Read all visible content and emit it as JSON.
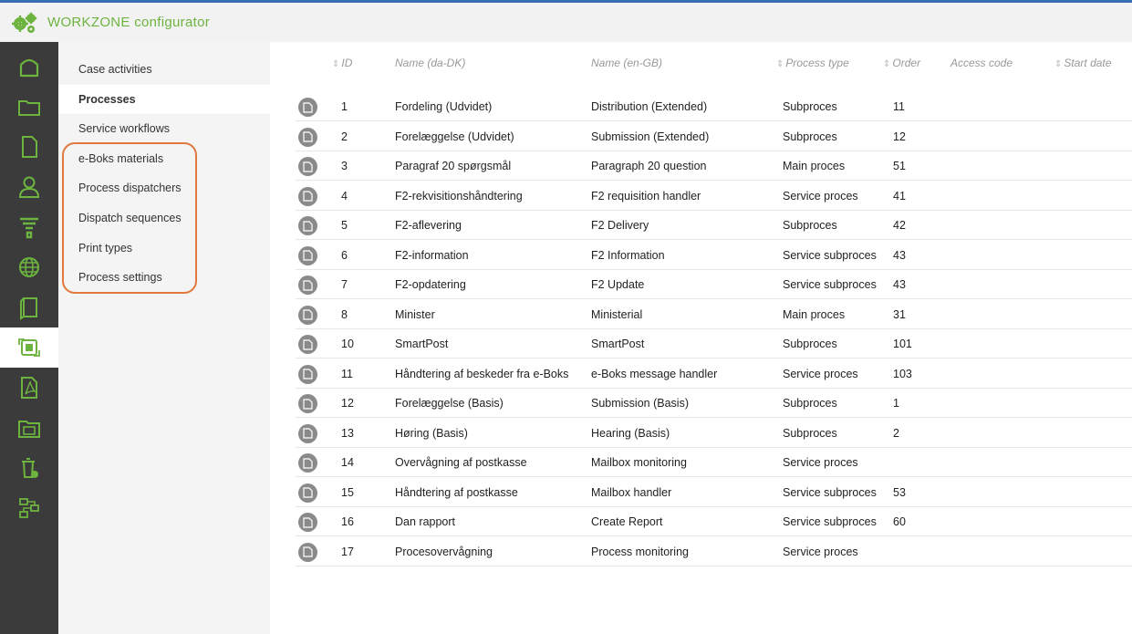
{
  "app": {
    "title_brand": "WORKZONE",
    "title_rest": " configurator",
    "accent": "#6db33f",
    "rail_bg": "#3b3b3b",
    "icon_color": "#6db33f"
  },
  "rail": {
    "items": [
      {
        "icon": "home-icon"
      },
      {
        "icon": "folder-icon"
      },
      {
        "icon": "document-icon"
      },
      {
        "icon": "user-icon"
      },
      {
        "icon": "filter-icon"
      },
      {
        "icon": "globe-icon"
      },
      {
        "icon": "book-icon"
      },
      {
        "icon": "workflow-icon",
        "active": true
      },
      {
        "icon": "pdf-icon"
      },
      {
        "icon": "archive-icon"
      },
      {
        "icon": "trash-icon"
      },
      {
        "icon": "flow-icon"
      }
    ]
  },
  "sidebar": {
    "items": [
      {
        "label": "Case activities"
      },
      {
        "label": "Processes",
        "active": true
      },
      {
        "label": "Service workflows"
      },
      {
        "label": "e-Boks materials"
      },
      {
        "label": "Process dispatchers"
      },
      {
        "label": "Dispatch sequences"
      },
      {
        "label": "Print types"
      },
      {
        "label": "Process settings"
      }
    ]
  },
  "table": {
    "columns": [
      {
        "label": "ID",
        "sortable": true
      },
      {
        "label": "Name (da-DK)",
        "sortable": false
      },
      {
        "label": "Name (en-GB)",
        "sortable": false
      },
      {
        "label": "Process type",
        "sortable": true
      },
      {
        "label": "Order",
        "sortable": true
      },
      {
        "label": "Access code",
        "sortable": false
      },
      {
        "label": "Start date",
        "sortable": true
      }
    ],
    "sort_glyph": "⇕",
    "rows": [
      {
        "id": "1",
        "name_da": "Fordeling (Udvidet)",
        "name_en": "Distribution (Extended)",
        "type": "Subproces",
        "order": "11"
      },
      {
        "id": "2",
        "name_da": "Forelæggelse (Udvidet)",
        "name_en": "Submission (Extended)",
        "type": "Subproces",
        "order": "12"
      },
      {
        "id": "3",
        "name_da": "Paragraf 20 spørgsmål",
        "name_en": "Paragraph 20 question",
        "type": "Main proces",
        "order": "51"
      },
      {
        "id": "4",
        "name_da": "F2-rekvisitionshåndtering",
        "name_en": "F2 requisition handler",
        "type": "Service proces",
        "order": "41"
      },
      {
        "id": "5",
        "name_da": "F2-aflevering",
        "name_en": "F2 Delivery",
        "type": "Subproces",
        "order": "42"
      },
      {
        "id": "6",
        "name_da": "F2-information",
        "name_en": "F2 Information",
        "type": "Service subproces",
        "order": "43"
      },
      {
        "id": "7",
        "name_da": "F2-opdatering",
        "name_en": "F2 Update",
        "type": "Service subproces",
        "order": "43"
      },
      {
        "id": "8",
        "name_da": "Minister",
        "name_en": "Ministerial",
        "type": "Main proces",
        "order": "31"
      },
      {
        "id": "10",
        "name_da": "SmartPost",
        "name_en": "SmartPost",
        "type": "Subproces",
        "order": "101"
      },
      {
        "id": "11",
        "name_da": "Håndtering af beskeder fra e-Boks",
        "name_en": "e-Boks message handler",
        "type": "Service proces",
        "order": "103"
      },
      {
        "id": "12",
        "name_da": "Forelæggelse (Basis)",
        "name_en": "Submission (Basis)",
        "type": "Subproces",
        "order": "1"
      },
      {
        "id": "13",
        "name_da": "Høring (Basis)",
        "name_en": "Hearing (Basis)",
        "type": "Subproces",
        "order": "2"
      },
      {
        "id": "14",
        "name_da": "Overvågning af postkasse",
        "name_en": "Mailbox monitoring",
        "type": "Service proces",
        "order": ""
      },
      {
        "id": "15",
        "name_da": "Håndtering af postkasse",
        "name_en": "Mailbox handler",
        "type": "Service subproces",
        "order": "53"
      },
      {
        "id": "16",
        "name_da": "Dan rapport",
        "name_en": "Create Report",
        "type": "Service subproces",
        "order": "60"
      },
      {
        "id": "17",
        "name_da": "Procesovervågning",
        "name_en": "Process monitoring",
        "type": "Service proces",
        "order": ""
      }
    ]
  }
}
